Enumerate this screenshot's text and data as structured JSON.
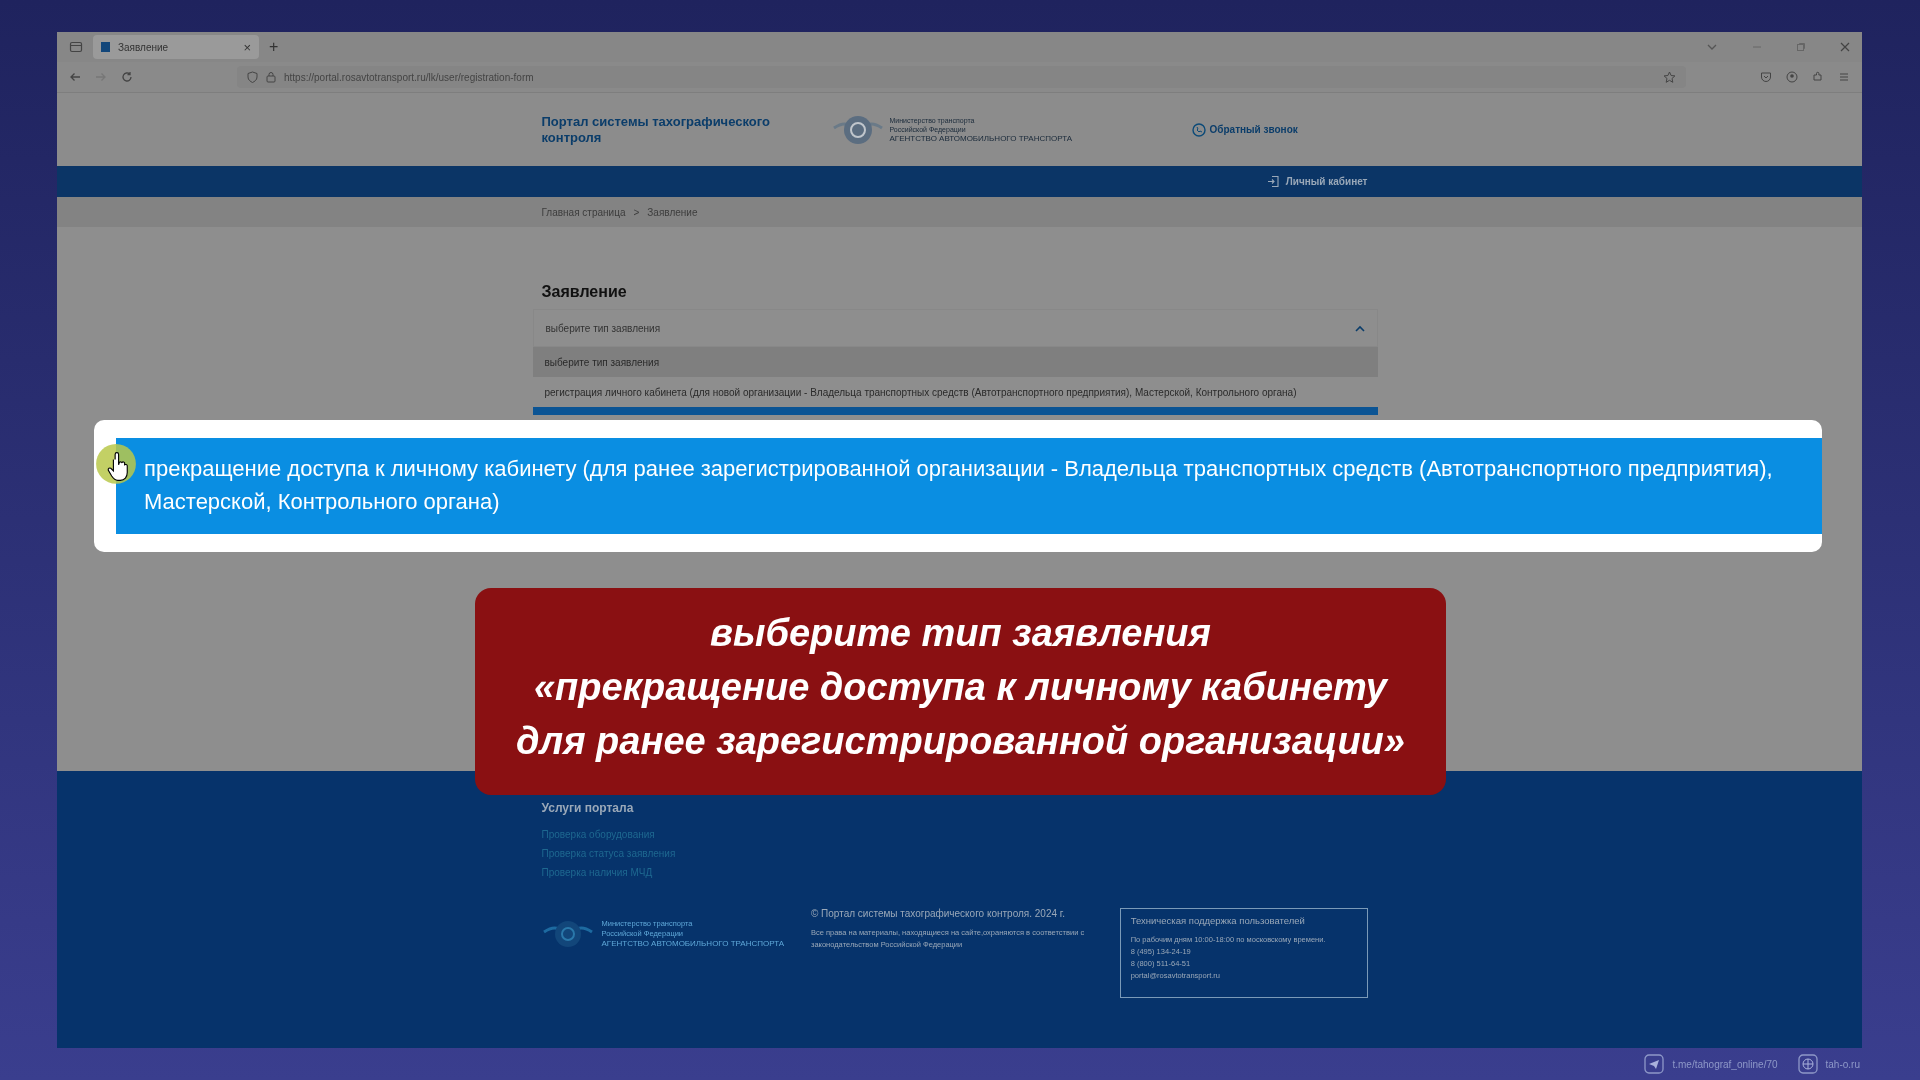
{
  "browser": {
    "tab_title": "Заявление",
    "tab_close": "×",
    "new_tab": "+",
    "url": "https://portal.rosavtotransport.ru/lk/user/registration-form"
  },
  "header": {
    "portal_title": "Портал системы тахографического контроля",
    "ministry_lines": [
      "Министерство транспорта",
      "Российской Федерации",
      "АГЕНТСТВО АВТОМОБИЛЬНОГО ТРАНСПОРТА"
    ],
    "callback": "Обратный звонок"
  },
  "nav": {
    "account": "Личный кабинет"
  },
  "breadcrumbs": {
    "items": [
      "Главная страница",
      "Заявление"
    ],
    "separator": ">"
  },
  "form": {
    "title": "Заявление",
    "select": {
      "value": "выберите тип заявления",
      "expanded": true
    },
    "options": [
      {
        "label": "выберите тип заявления",
        "selected": true,
        "hovered": false
      },
      {
        "label": "регистрация личного кабинета (для новой организации - Владельца транспортных средств (Автотранспортного предприятия), Мастерской, Контрольного органа)",
        "selected": false,
        "hovered": false
      },
      {
        "label": "прекращение доступа к личному кабинету (для ранее зарегистрированной организации - Владельца транспортных средств (Автотранспортного предприятия), Мастерской, Контрольного органа)",
        "selected": false,
        "hovered": true
      }
    ]
  },
  "callout": {
    "text": "выберите тип заявления\n«прекращение доступа к личному кабинету\nдля ранее зарегистрированной организации»"
  },
  "footer": {
    "services_title": "Услуги портала",
    "links": [
      "Проверка оборудования",
      "Проверка статуса заявления",
      "Проверка наличия МЧД"
    ],
    "ministry_lines": [
      "Министерство транспорта",
      "Российской Федерации",
      "АГЕНТСТВО АВТОМОБИЛЬНОГО ТРАНСПОРТА"
    ],
    "copyright": "© Портал системы тахографического контроля. 2024 г.",
    "rights": "Все права на материалы, находящиеся на сайте,охраняются в соответствии с законодательством Российской Федерации",
    "support": {
      "title": "Техническая поддержка пользователей",
      "lines": [
        "По рабочим дням 10:00-18:00 по московскому времени.",
        "8 (495) 134-24-19",
        "8 (800) 511-64-51",
        "portal@rosavtotransport.ru"
      ]
    }
  },
  "channel_links": [
    {
      "kind": "telegram",
      "label": "t.me/tahograf_online/70"
    },
    {
      "kind": "web",
      "label": "tah-o.ru"
    }
  ]
}
